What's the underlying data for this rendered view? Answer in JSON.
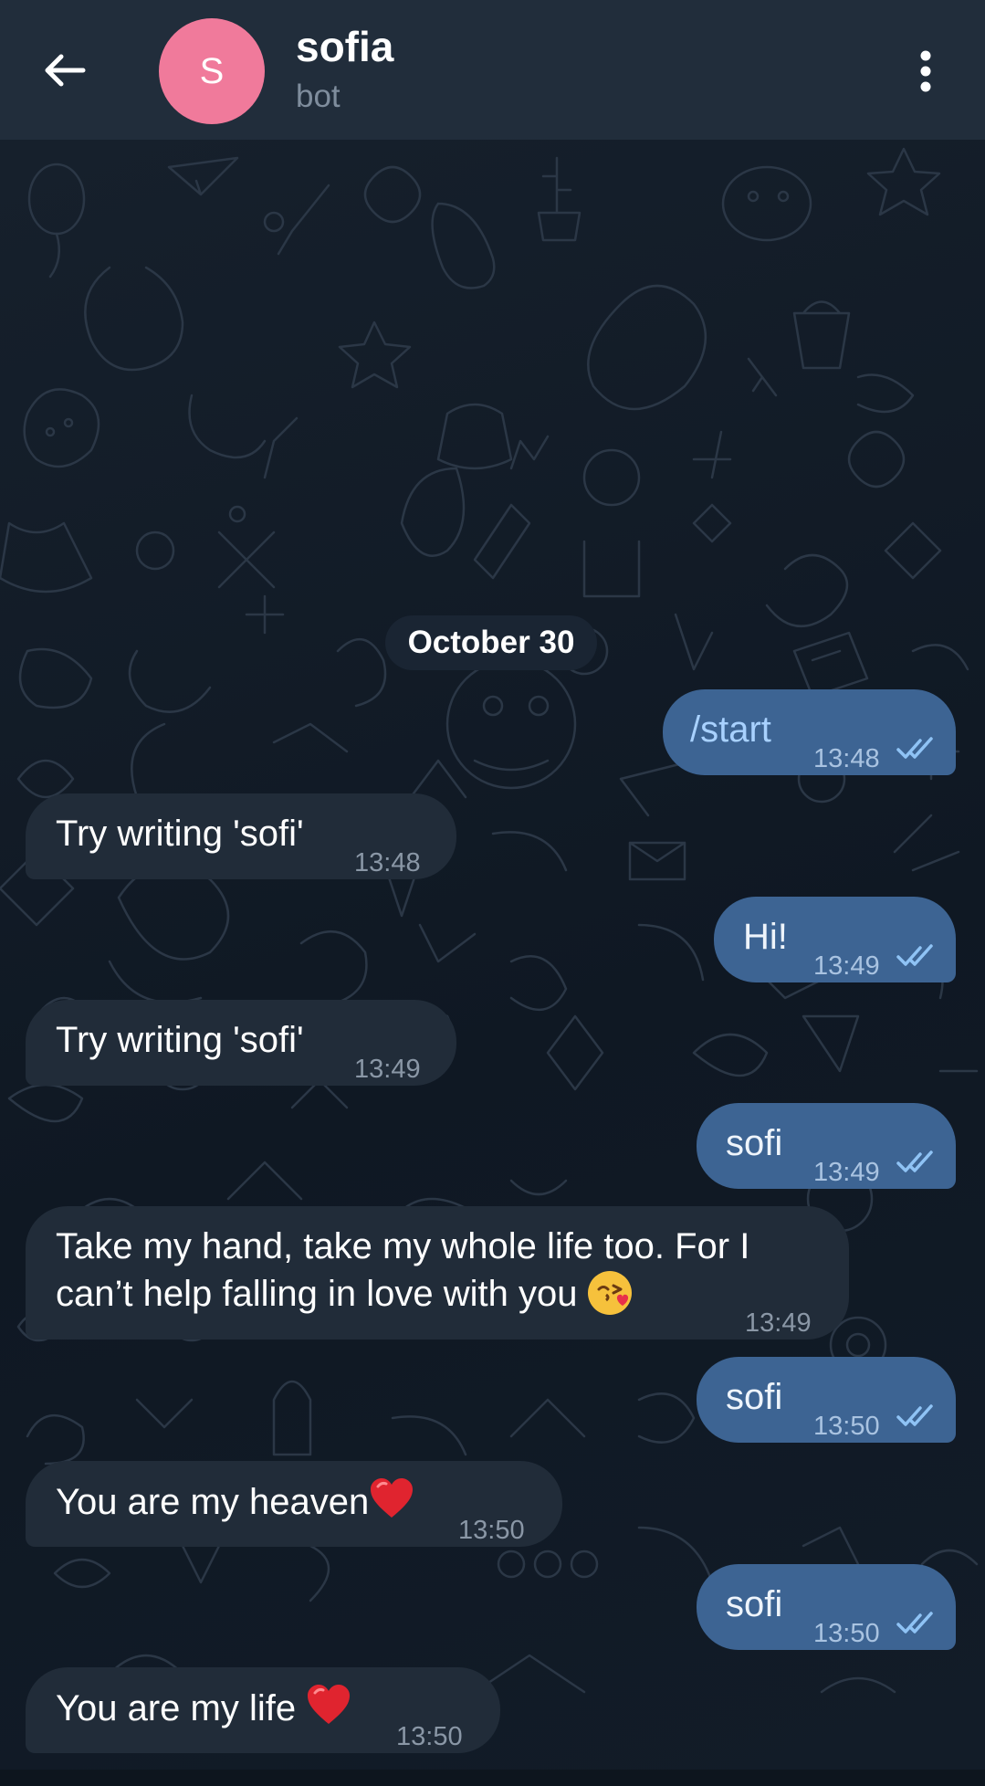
{
  "header": {
    "back_label": "←",
    "avatar_letter": "S",
    "title": "sofia",
    "subtitle": "bot"
  },
  "date_separator": "October 30",
  "messages": [
    {
      "direction": "out",
      "text": "/start",
      "time": "13:48"
    },
    {
      "direction": "in",
      "text": "Try writing 'sofi'",
      "time": "13:48"
    },
    {
      "direction": "out",
      "text": "Hi!",
      "time": "13:49"
    },
    {
      "direction": "in",
      "text": "Try writing 'sofi'",
      "time": "13:49"
    },
    {
      "direction": "out",
      "text": "sofi",
      "time": "13:49"
    },
    {
      "direction": "in",
      "text": "Take my hand, take my whole life too. For I",
      "text2": "can’t help falling in love with you",
      "emoji": "kissing-face-with-heart",
      "time": "13:49"
    },
    {
      "direction": "out",
      "text": "sofi",
      "time": "13:50"
    },
    {
      "direction": "in",
      "text": "You are my heaven",
      "emoji": "red-heart",
      "time": "13:50"
    },
    {
      "direction": "out",
      "text": "sofi",
      "time": "13:50"
    },
    {
      "direction": "in",
      "text": "You are my life ",
      "emoji": "red-heart",
      "time": "13:50"
    }
  ],
  "colors": {
    "header_bg": "#212d3b",
    "avatar_bg": "#f07a9b",
    "incoming_bubble": "#212c39",
    "outgoing_bubble": "#3d6493",
    "command_text": "#a8d1ff",
    "read_ticks": "#8fc3f5"
  }
}
